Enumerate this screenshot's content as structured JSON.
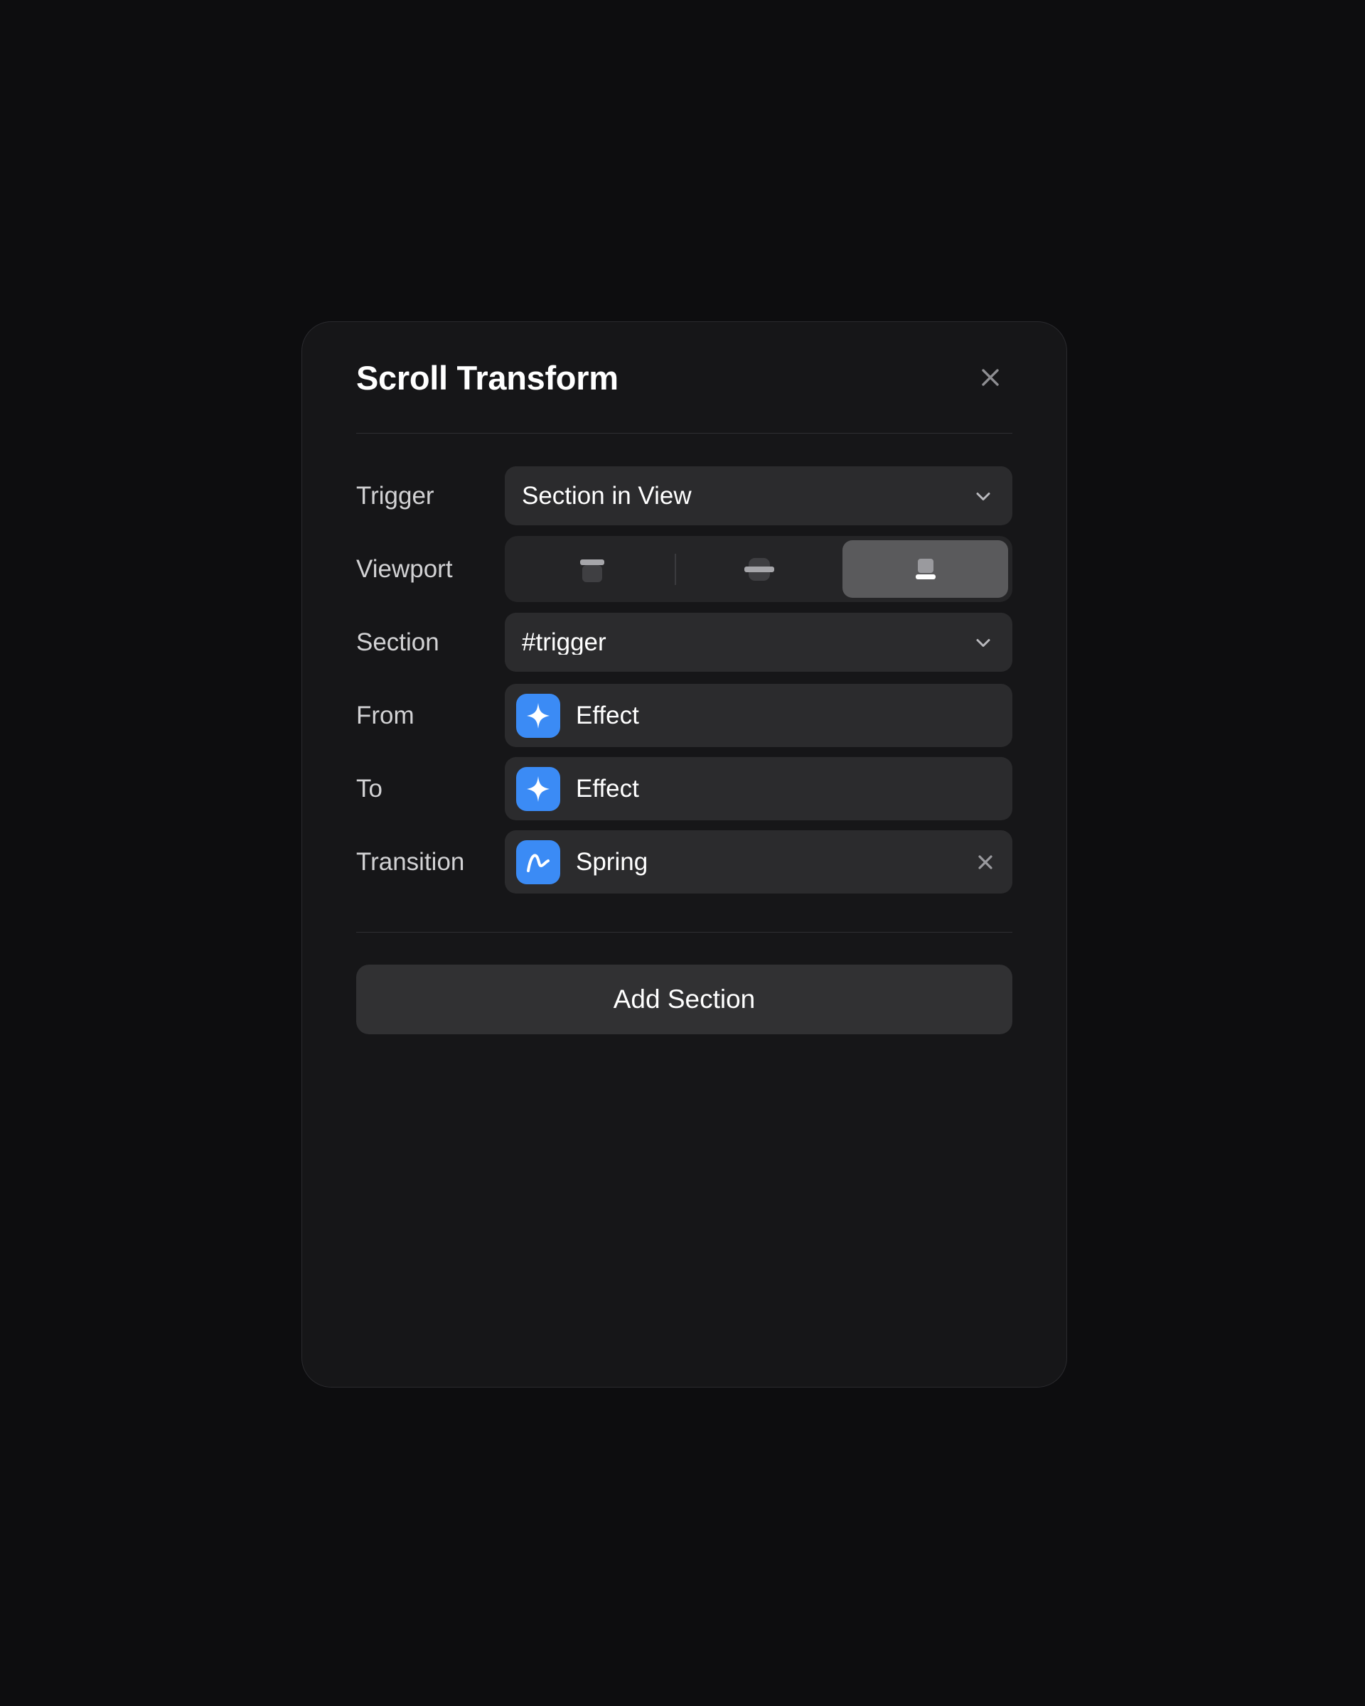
{
  "panel": {
    "title": "Scroll Transform",
    "close_icon": "close-icon",
    "accent_color": "#3b8bf5",
    "background_color": "#161618",
    "field_color": "#2b2b2d",
    "page_background": "#0d0d0f"
  },
  "rows": {
    "trigger": {
      "label": "Trigger",
      "value": "Section in View",
      "chevron_icon": "chevron-down-icon"
    },
    "viewport": {
      "label": "Viewport",
      "options": [
        {
          "name": "desktop",
          "icon": "desktop-icon",
          "selected": false
        },
        {
          "name": "tablet",
          "icon": "tablet-icon",
          "selected": false
        },
        {
          "name": "mobile",
          "icon": "mobile-icon",
          "selected": true
        }
      ]
    },
    "section": {
      "label": "Section",
      "value": "#trigger",
      "chevron_icon": "chevron-down-icon"
    },
    "from": {
      "label": "From",
      "value": "Effect",
      "icon": "sparkle-icon"
    },
    "to": {
      "label": "To",
      "value": "Effect",
      "icon": "sparkle-icon"
    },
    "transition": {
      "label": "Transition",
      "value": "Spring",
      "icon": "spring-curve-icon",
      "clear_icon": "close-icon"
    }
  },
  "footer": {
    "add_section_label": "Add Section"
  }
}
